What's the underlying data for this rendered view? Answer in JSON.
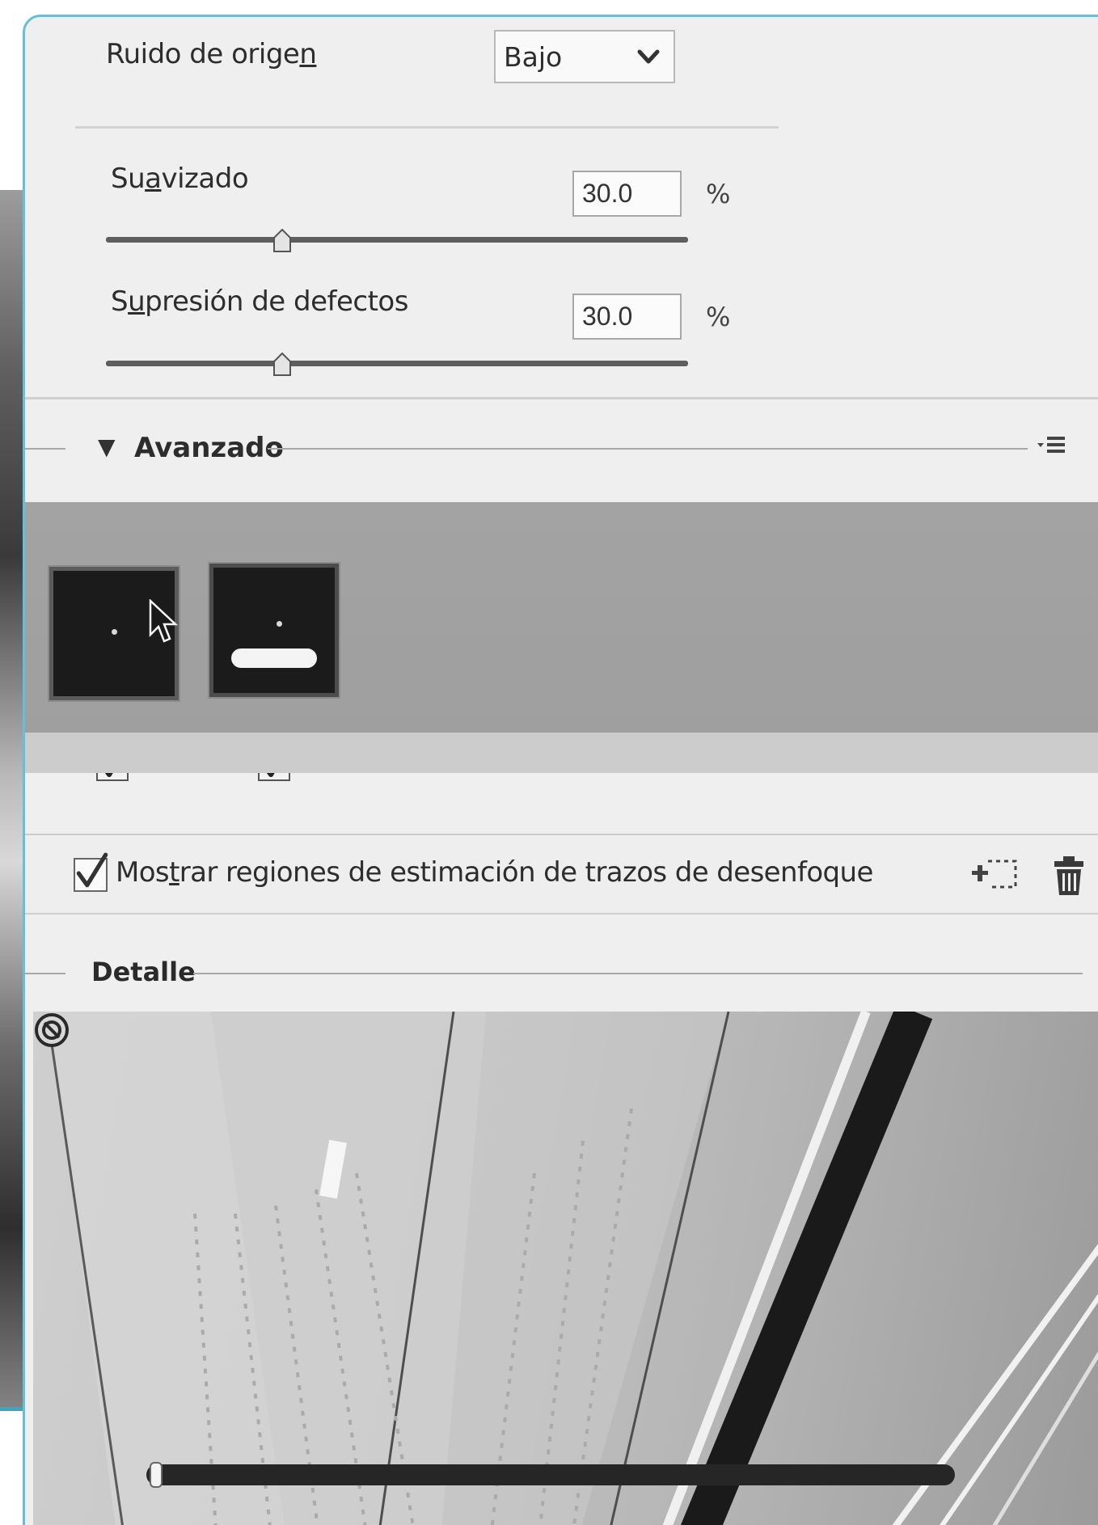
{
  "noise": {
    "label_pre": "Ruido de orige",
    "label_key": "n",
    "dropdown_value": "Bajo"
  },
  "smoothing": {
    "label_pre": "Su",
    "label_key": "a",
    "label_post": "vizado",
    "value": "30.0",
    "unit": "%",
    "level": 30
  },
  "artifact": {
    "label_pre": "S",
    "label_key": "u",
    "label_post": "presión de defectos",
    "value": "30.0",
    "unit": "%",
    "level": 30
  },
  "advanced": {
    "title": "Avanzado",
    "kernels": [
      {
        "checked": true,
        "selected": false
      },
      {
        "checked": true,
        "selected": true
      }
    ]
  },
  "show_regions": {
    "label_pre": "Mos",
    "label_key": "t",
    "label_post": "rar regiones de estimación de trazos de desenfoque",
    "checked": true
  },
  "detail": {
    "title": "Detalle"
  },
  "icons": {
    "dropdown": "chevron-down-icon",
    "panel_menu": "panel-menu-icon",
    "add_region": "add-region-icon",
    "delete": "trash-icon",
    "unpin": "no-symbol-icon"
  }
}
